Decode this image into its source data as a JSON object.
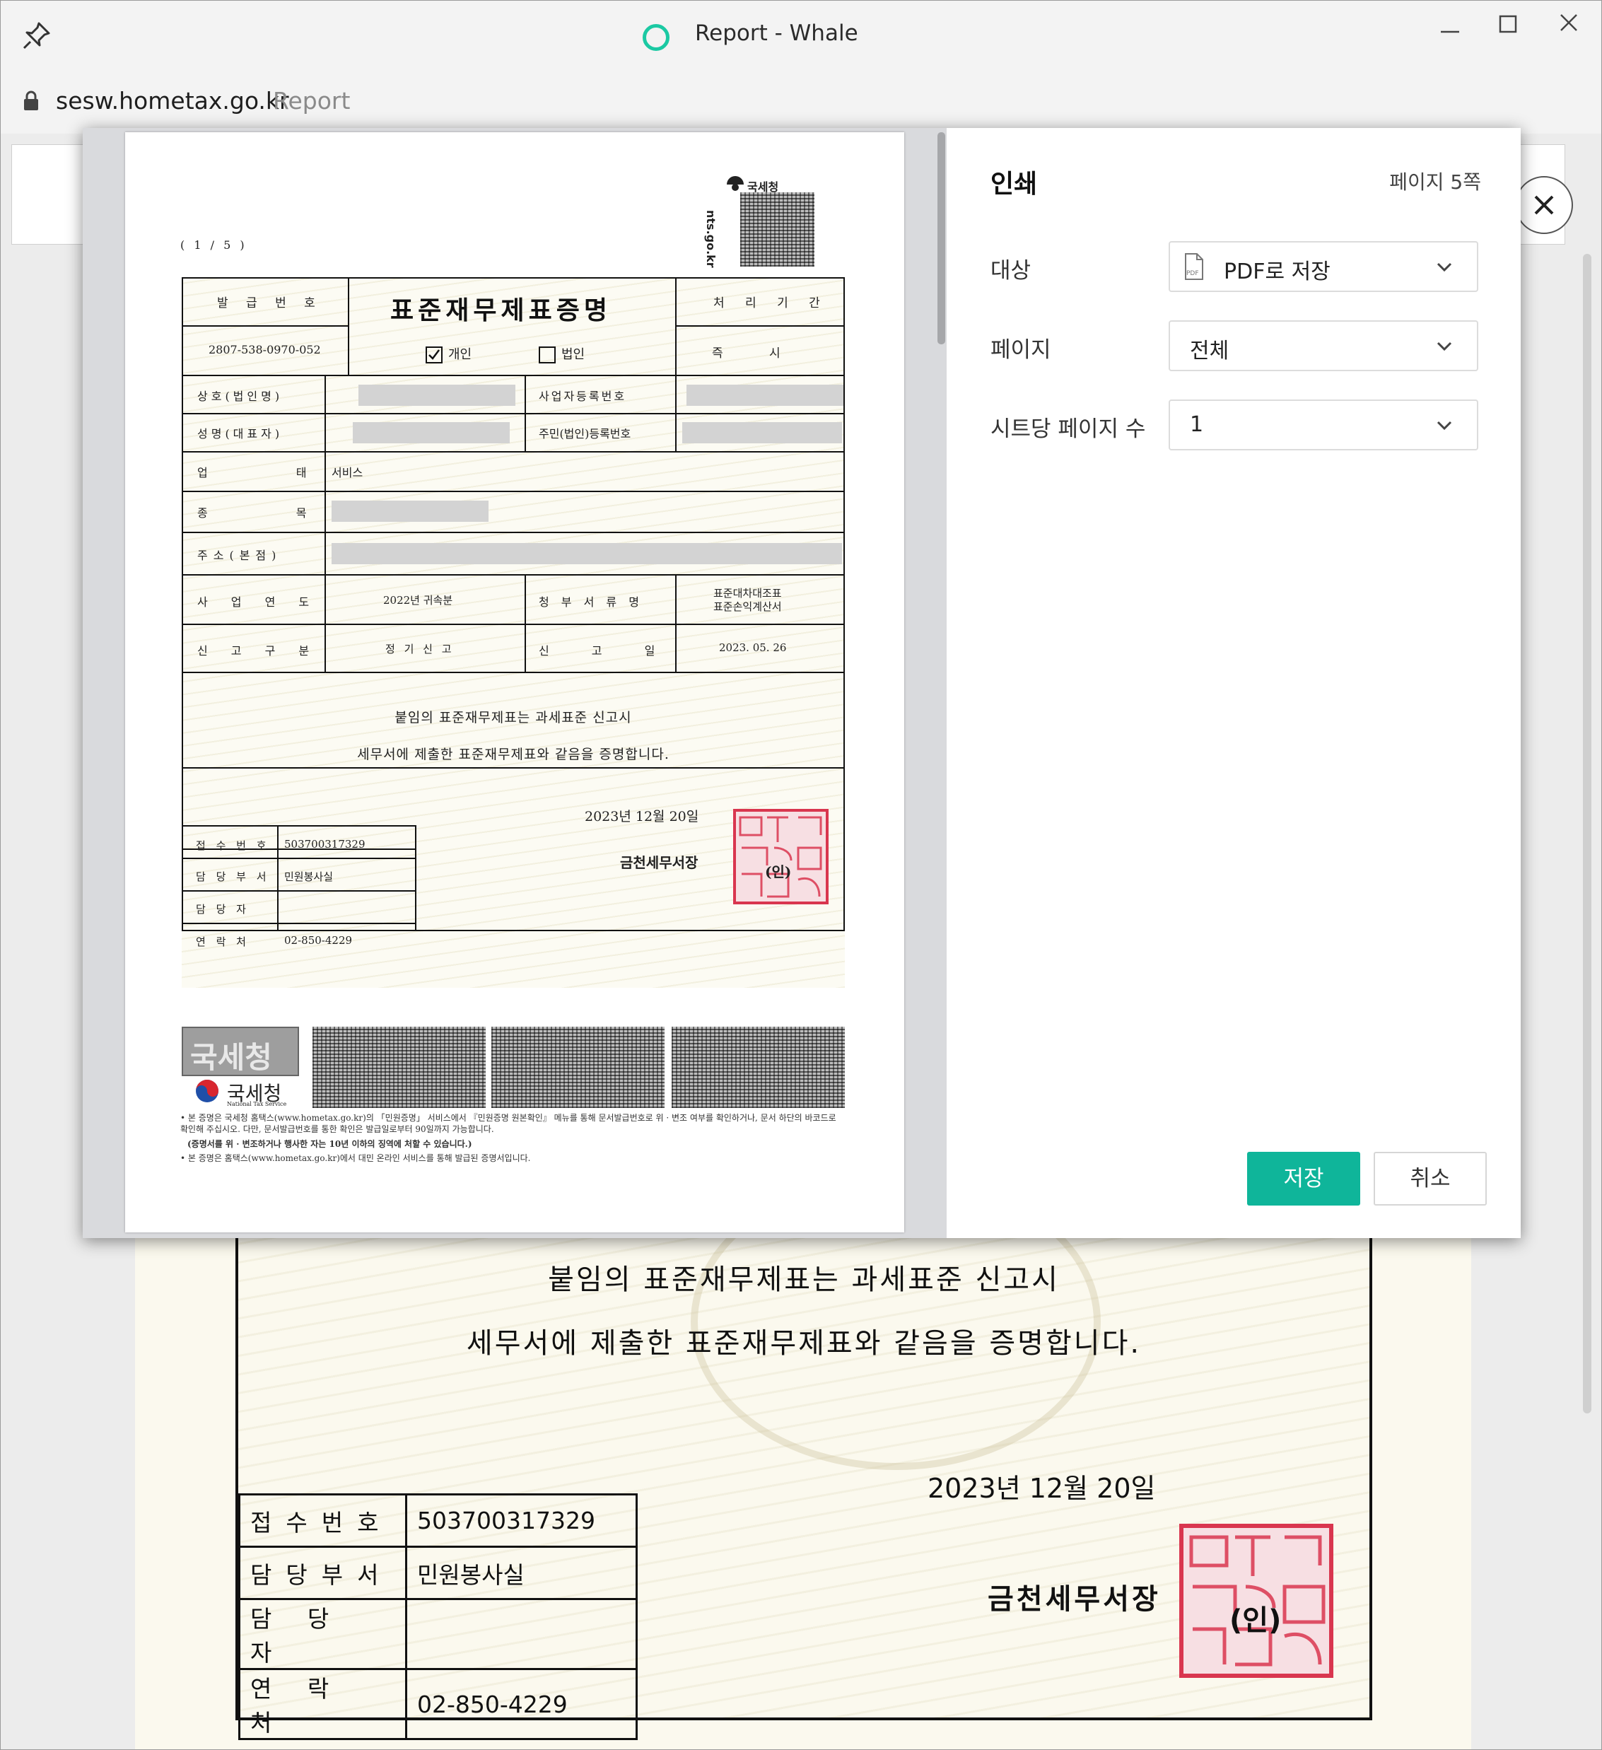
{
  "window": {
    "title": "Report - Whale",
    "url_host": "sesw.hometax.go.kr",
    "url_path": "Report"
  },
  "print_dialog": {
    "title": "인쇄",
    "page_count": "페이지 5쪽",
    "destination_label": "대상",
    "destination_value": "PDF로 저장",
    "pages_label": "페이지",
    "pages_value": "전체",
    "pages_per_sheet_label": "시트당 페이지 수",
    "pages_per_sheet_value": "1",
    "save_button": "저장",
    "cancel_button": "취소"
  },
  "certificate": {
    "page_indicator": "( 1 / 5 )",
    "logo_text": "국세청",
    "site_vertical": "nts.go.kr",
    "title": "표준재무제표증명",
    "issue_no_label": "발 급 번 호",
    "issue_no": "2807-538-0970-052",
    "processing_label": "처 리 기 간",
    "processing_value": "즉 시",
    "check_individual": "개인",
    "check_corporate": "법인",
    "row_company": "상호(법인명)",
    "row_bizno": "사업자등록번호",
    "row_name": "성명(대표자)",
    "row_residentno": "주민(법인)등록번호",
    "row_business_type": "업 태",
    "business_type_value": "서비스",
    "row_item": "종 목",
    "row_address": "주소(본점)",
    "row_year": "사 업 연 도",
    "year_value": "2022년 귀속분",
    "row_doc_name": "청 부 서 류 명",
    "doc_name_value_1": "표준대차대조표",
    "doc_name_value_2": "표준손익계산서",
    "row_report_type": "신 고 구 분",
    "report_type_value": "정 기 신 고",
    "row_report_date": "신 고 일",
    "report_date_value": "2023. 05. 26",
    "statement_1": "붙임의 표준재무제표는 과세표준 신고시",
    "statement_2": "세무서에 제출한 표준재무제표와 같음을 증명합니다.",
    "issue_date": "2023년 12월  20일",
    "office": "금천세무서장",
    "seal_mark": "(인)",
    "receipt_label": "접 수 번 호",
    "receipt_no": "503700317329",
    "dept_label": "담 당 부 서",
    "dept_value": "민원봉사실",
    "staff_label": "담 당 자",
    "contact_label": "연 락 처",
    "contact_value": "02-850-4229",
    "footer_logo": "국세청",
    "footer_logo_sub": "National Tax Service",
    "note_1": "• 본 증명은 국세청 홈택스(www.hometax.go.kr)의 「민원증명」 서비스에서 『민원증명 원본확인』 메뉴를 통해 문서발급번호로 위 · 변조 여부를 확인하거나, 문서 하단의 바코드로 확인해 주십시오. 다만, 문서발급번호를 통한 확인은 발급일로부터 90일까지 가능합니다.",
    "note_2": "(증명서를 위 · 변조하거나 행사한 자는 10년 이하의 징역에 처할 수 있습니다.)",
    "note_3": "• 본 증명은 홈택스(www.hometax.go.kr)에서 대민 온라인 서비스를 통해 발급된 증명서입니다."
  },
  "background_page": {
    "statement_1": "붙임의 표준재무제표는 과세표준 신고시",
    "statement_2": "세무서에 제출한 표준재무제표와 같음을 증명합니다.",
    "issue_date": "2023년  12월   20일",
    "office": "금천세무서장",
    "seal_mark": "(인)",
    "rows": [
      {
        "label": "접수번호",
        "value": "503700317329"
      },
      {
        "label": "담당부서",
        "value": "민원봉사실"
      },
      {
        "label": "담 당 자",
        "value": ""
      },
      {
        "label": "연 락 처",
        "value": "02-850-4229"
      }
    ]
  },
  "colors": {
    "accent": "#0fb59a",
    "whale_logo": "#1bc9a3",
    "seal_red": "#d9364f"
  }
}
